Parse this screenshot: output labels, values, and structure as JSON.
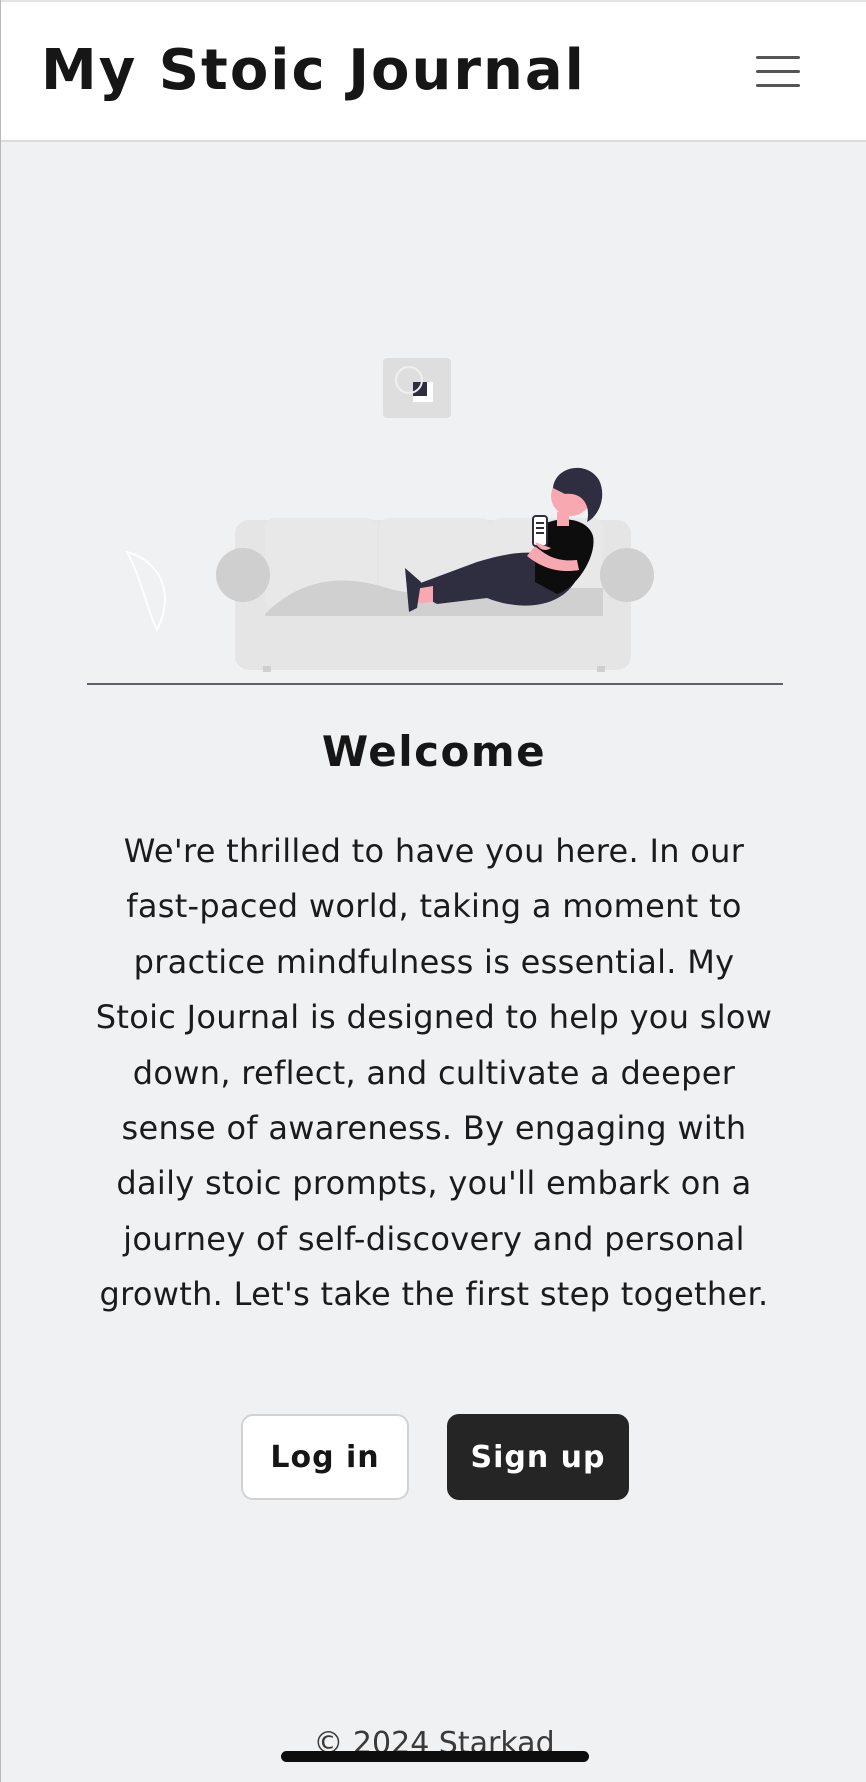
{
  "header": {
    "title": "My Stoic Journal",
    "menu_icon": "hamburger-menu-icon"
  },
  "hero": {
    "illustration": "person-relaxing-on-couch-with-phone",
    "heading": "Welcome",
    "body": "We're thrilled to have you here. In our fast-paced world, taking a moment to practice mindfulness is essential. My Stoic Journal is designed to help you slow down, reflect, and cultivate a deeper sense of awareness. By engaging with daily stoic prompts, you'll embark on a journey of self-discovery and personal growth. Let's take the first step together."
  },
  "actions": {
    "login_label": "Log in",
    "signup_label": "Sign up"
  },
  "footer": {
    "copyright": "© 2024 Starkad"
  },
  "colors": {
    "background": "#f0f1f3",
    "header_bg": "#ffffff",
    "primary_button": "#252525",
    "text": "#161616"
  }
}
